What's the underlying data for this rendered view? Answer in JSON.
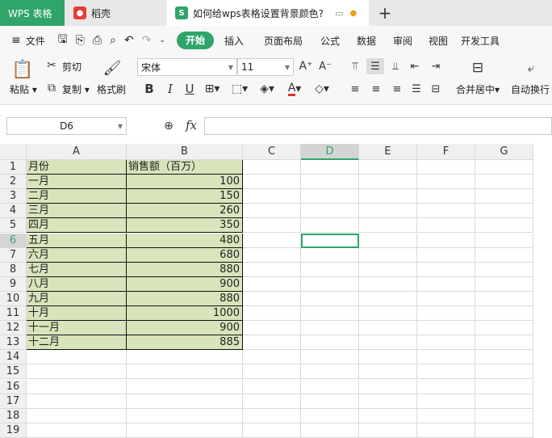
{
  "tabs": {
    "app": "WPS 表格",
    "doc1": "稻壳",
    "doc2": "如何给wps表格设置背景颜色?",
    "doc2_badge": "S"
  },
  "menu": {
    "file": "文件",
    "items": [
      "开始",
      "插入",
      "页面布局",
      "公式",
      "数据",
      "审阅",
      "视图",
      "开发工具"
    ],
    "active": "开始"
  },
  "ribbon": {
    "paste": "粘贴",
    "cut": "剪切",
    "copy": "复制",
    "format_painter": "格式刷",
    "font_name": "宋体",
    "font_size": "11",
    "merge_center": "合并居中",
    "wrap": "自动换行"
  },
  "formula": {
    "cell_ref": "D6",
    "fx": "fx",
    "content": ""
  },
  "columns": [
    "A",
    "B",
    "C",
    "D",
    "E",
    "F",
    "G"
  ],
  "rows": [
    "1",
    "2",
    "3",
    "4",
    "5",
    "6",
    "7",
    "8",
    "9",
    "10",
    "11",
    "12",
    "13",
    "14",
    "15",
    "16",
    "17",
    "18",
    "19"
  ],
  "table": {
    "header": [
      "月份",
      "销售额（百万）"
    ],
    "data": [
      [
        "一月",
        "100"
      ],
      [
        "二月",
        "150"
      ],
      [
        "三月",
        "260"
      ],
      [
        "四月",
        "350"
      ],
      [
        "五月",
        "480"
      ],
      [
        "六月",
        "680"
      ],
      [
        "七月",
        "880"
      ],
      [
        "八月",
        "900"
      ],
      [
        "九月",
        "880"
      ],
      [
        "十月",
        "1000"
      ],
      [
        "十一月",
        "900"
      ],
      [
        "十二月",
        "885"
      ]
    ]
  },
  "selected": {
    "col": "D",
    "row": "6"
  },
  "colors": {
    "accent": "#2fa56a",
    "table_fill": "#d8e4bc"
  },
  "icons": [
    "paste-icon",
    "cut-icon",
    "copy-icon",
    "format-painter-icon",
    "undo-icon",
    "redo-icon",
    "save-icon",
    "print-icon",
    "zoom-icon"
  ]
}
